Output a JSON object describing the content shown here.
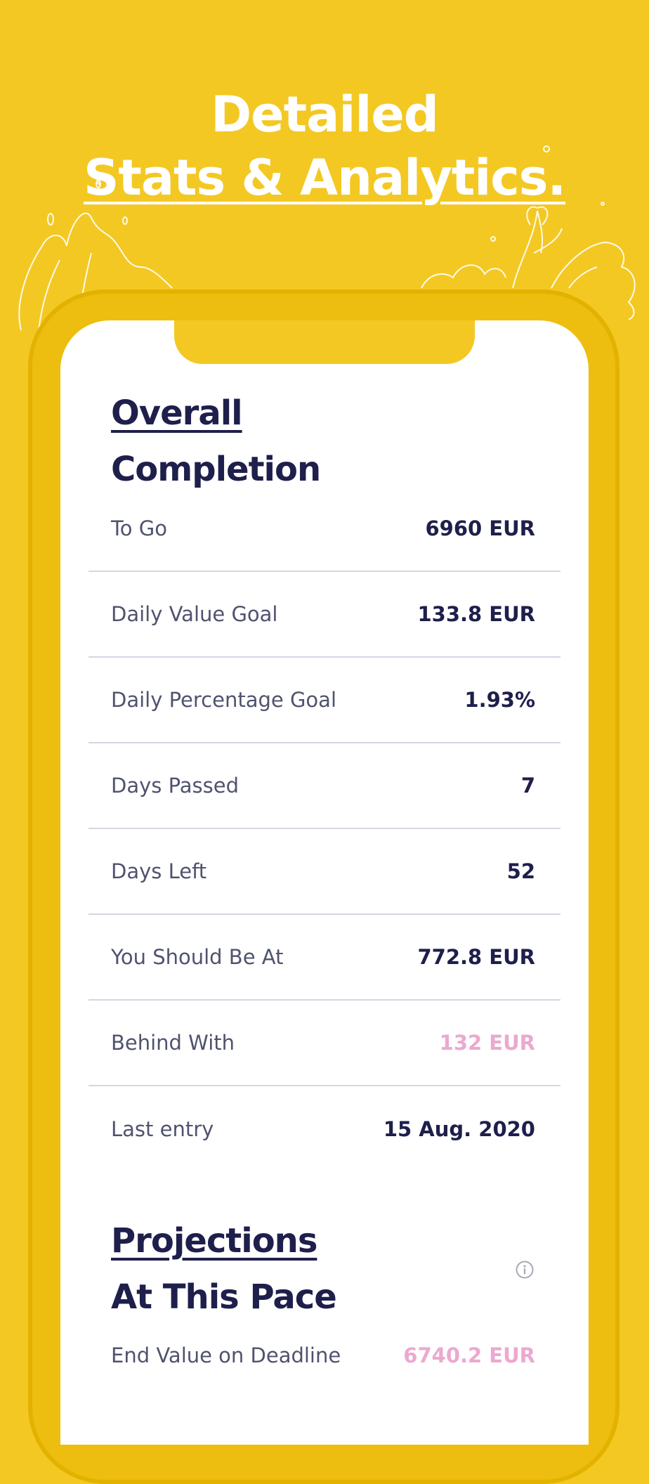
{
  "headline": {
    "line1": "Detailed",
    "line2": "Stats & Analytics."
  },
  "overall": {
    "title_line1": "Overall",
    "title_line2": "Completion",
    "rows": [
      {
        "label": "To Go",
        "value": "6960 EUR"
      },
      {
        "label": "Daily Value Goal",
        "value": "133.8 EUR"
      },
      {
        "label": "Daily Percentage Goal",
        "value": "1.93%"
      },
      {
        "label": "Days Passed",
        "value": "7"
      },
      {
        "label": "Days Left",
        "value": "52"
      },
      {
        "label": "You Should Be At",
        "value": "772.8 EUR"
      },
      {
        "label": "Behind With",
        "value": "132 EUR"
      },
      {
        "label": "Last entry",
        "value": "15 Aug. 2020"
      }
    ]
  },
  "projections": {
    "title_line1": "Projections",
    "title_line2": "At This Pace",
    "info_icon": "info-icon",
    "rows": [
      {
        "label": "End Value on Deadline",
        "value": "6740.2 EUR"
      }
    ]
  },
  "colors": {
    "background": "#F3C823",
    "text_dark": "#1E1F4B",
    "text_label": "#50536E",
    "accent_pink": "#EBA9CF",
    "divider": "#D6D6E2"
  }
}
